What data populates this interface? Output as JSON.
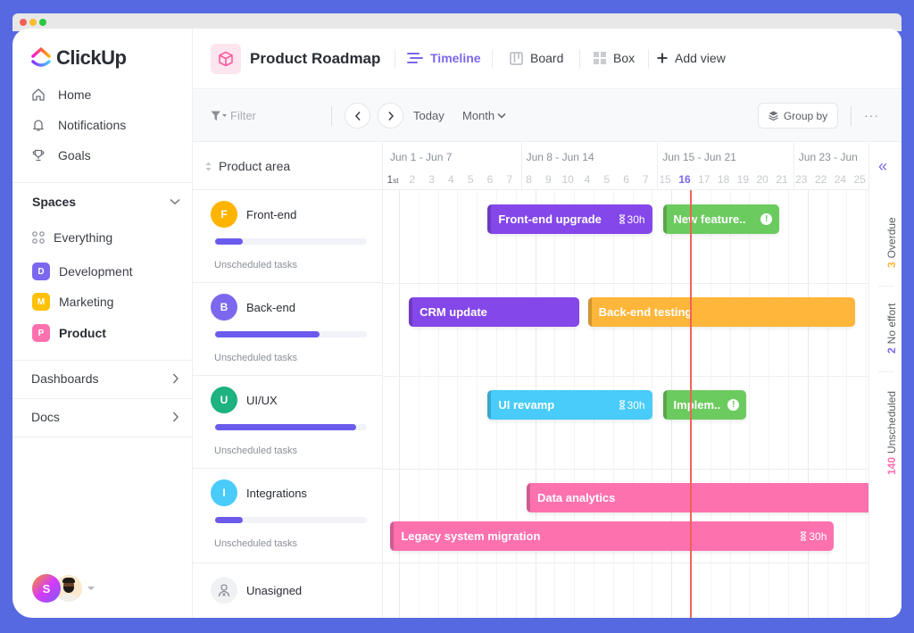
{
  "app": {
    "logo_text": "ClickUp"
  },
  "sidebar": {
    "nav": [
      {
        "label": "Home",
        "icon": "home-icon"
      },
      {
        "label": "Notifications",
        "icon": "bell-icon"
      },
      {
        "label": "Goals",
        "icon": "trophy-icon"
      }
    ],
    "spaces_label": "Spaces",
    "spaces": [
      {
        "label": "Everything",
        "badge": "",
        "color": ""
      },
      {
        "label": "Development",
        "badge": "D",
        "color": "#7b68ee"
      },
      {
        "label": "Marketing",
        "badge": "M",
        "color": "#ffc107"
      },
      {
        "label": "Product",
        "badge": "P",
        "color": "#fd71af"
      }
    ],
    "dashboards_label": "Dashboards",
    "docs_label": "Docs",
    "user_avatar_initial": "S"
  },
  "header": {
    "project_title": "Product Roadmap",
    "views": [
      {
        "label": "Timeline",
        "icon": "timeline-icon",
        "active": true
      },
      {
        "label": "Board",
        "icon": "board-icon",
        "active": false
      },
      {
        "label": "Box",
        "icon": "box-icon",
        "active": false
      }
    ],
    "add_view_label": "Add view"
  },
  "toolbar": {
    "filter_placeholder": "Filter",
    "today_label": "Today",
    "range_label": "Month",
    "group_by_label": "Group by",
    "more_label": "···"
  },
  "list": {
    "header_label": "Product area",
    "groups": [
      {
        "initial": "F",
        "name": "Front-end",
        "color": "#ffb400",
        "progress": 0.18,
        "unscheduled_label": "Unscheduled tasks"
      },
      {
        "initial": "B",
        "name": "Back-end",
        "color": "#7b68ee",
        "progress": 0.69,
        "unscheduled_label": "Unscheduled tasks"
      },
      {
        "initial": "U",
        "name": "UI/UX",
        "color": "#1db27f",
        "progress": 0.93,
        "unscheduled_label": "Unscheduled tasks"
      },
      {
        "initial": "I",
        "name": "Integrations",
        "color": "#49ccf9",
        "progress": 0.18,
        "unscheduled_label": "Unscheduled tasks"
      }
    ],
    "unassigned_label": "Unasigned"
  },
  "timeline": {
    "weeks": [
      "Jun 1 - Jun 7",
      "Jun 8 - Jun 14",
      "Jun 15 - Jun 21",
      "Jun 23 - Jun"
    ],
    "days": [
      "1",
      "2",
      "3",
      "4",
      "5",
      "6",
      "7",
      "8",
      "9",
      "10",
      "4",
      "5",
      "6",
      "7",
      "15",
      "16",
      "17",
      "18",
      "19",
      "20",
      "21",
      "23",
      "22",
      "24",
      "25"
    ],
    "first_day_suffix": "st",
    "today_index": 15,
    "tasks": [
      {
        "name": "Front-end upgrade",
        "hours": "30h",
        "warn": false,
        "color": "#8447ea",
        "group": 0,
        "lane": 0,
        "start": 5.2,
        "end": 13.65
      },
      {
        "name": "New feature..",
        "hours": "",
        "warn": true,
        "color": "#6ccb5f",
        "group": 0,
        "lane": 0,
        "start": 14.2,
        "end": 20.2
      },
      {
        "name": "CRM update",
        "hours": "",
        "warn": false,
        "color": "#8447ea",
        "group": 1,
        "lane": 0,
        "start": 1.15,
        "end": 9.9
      },
      {
        "name": "Back-end testing",
        "hours": "",
        "warn": false,
        "color": "#ffb63a",
        "group": 1,
        "lane": 0,
        "start": 10.35,
        "end": 24.1
      },
      {
        "name": "UI revamp",
        "hours": "30h",
        "warn": false,
        "color": "#49ccf9",
        "group": 2,
        "lane": 0,
        "start": 5.2,
        "end": 13.65
      },
      {
        "name": "Implem..",
        "hours": "",
        "warn": true,
        "color": "#6ccb5f",
        "group": 2,
        "lane": 0,
        "start": 14.2,
        "end": 18.5
      },
      {
        "name": "Data analytics",
        "hours": "",
        "warn": false,
        "color": "#fd71af",
        "group": 3,
        "lane": 0,
        "start": 7.2,
        "end": 25.5
      },
      {
        "name": "Legacy system migration",
        "hours": "30h",
        "warn": false,
        "color": "#fd71af",
        "group": 3,
        "lane": 1,
        "start": 0.2,
        "end": 23.0
      }
    ]
  },
  "rail": {
    "items": [
      {
        "count": "3",
        "label": "Overdue",
        "color": "#ffb63a"
      },
      {
        "count": "2",
        "label": "No effort",
        "color": "#7b68ee"
      },
      {
        "count": "140",
        "label": "Unscheduled",
        "color": "#fd71af"
      }
    ]
  }
}
